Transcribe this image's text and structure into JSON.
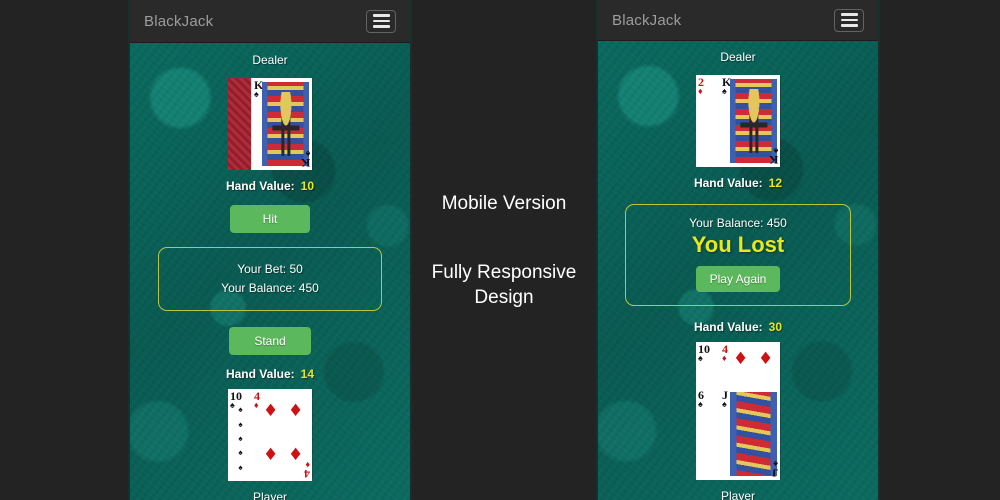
{
  "page": {
    "background_color": "#232323",
    "felt_color": "#0a5b52",
    "accent_green": "#5cb85c",
    "accent_yellow": "#e8e81e",
    "border_yellow": "#b9c63a"
  },
  "middle_copy": {
    "line1": "Mobile Version",
    "line2": "Fully Responsive Design"
  },
  "left_phone": {
    "navbar": {
      "brand": "BlackJack",
      "menu_icon": "hamburger-menu-icon"
    },
    "dealer": {
      "label": "Dealer",
      "hand_value_label": "Hand Value:",
      "hand_value": "10",
      "cards": [
        {
          "rank": "",
          "suit": "back",
          "facedown": true
        },
        {
          "rank": "K",
          "suit": "spades",
          "facedown": false
        }
      ]
    },
    "hit_button": "Hit",
    "bet_box": {
      "bet_line": "Your Bet: 50",
      "balance_line": "Your Balance: 450"
    },
    "stand_button": "Stand",
    "player": {
      "label": "Player",
      "hand_value_label": "Hand Value:",
      "hand_value": "14",
      "cards": [
        {
          "rank": "10",
          "suit": "spades",
          "facedown": false
        },
        {
          "rank": "4",
          "suit": "diamonds",
          "facedown": false
        }
      ]
    }
  },
  "right_phone": {
    "navbar": {
      "brand": "BlackJack",
      "menu_icon": "hamburger-menu-icon"
    },
    "dealer": {
      "label": "Dealer",
      "hand_value_label": "Hand Value:",
      "hand_value": "12",
      "cards": [
        {
          "rank": "2",
          "suit": "diamonds",
          "facedown": false
        },
        {
          "rank": "K",
          "suit": "spades",
          "facedown": false
        }
      ]
    },
    "result_box": {
      "balance_line": "Your Balance: 450",
      "verdict": "You Lost",
      "play_again_button": "Play Again"
    },
    "player": {
      "label": "Player",
      "hand_value_label": "Hand Value:",
      "hand_value": "30",
      "cards_row1": [
        {
          "rank": "10",
          "suit": "spades",
          "facedown": false
        },
        {
          "rank": "4",
          "suit": "diamonds",
          "facedown": false
        }
      ],
      "cards_row2": [
        {
          "rank": "6",
          "suit": "spades",
          "facedown": false
        },
        {
          "rank": "J",
          "suit": "spades",
          "facedown": false
        }
      ]
    }
  }
}
